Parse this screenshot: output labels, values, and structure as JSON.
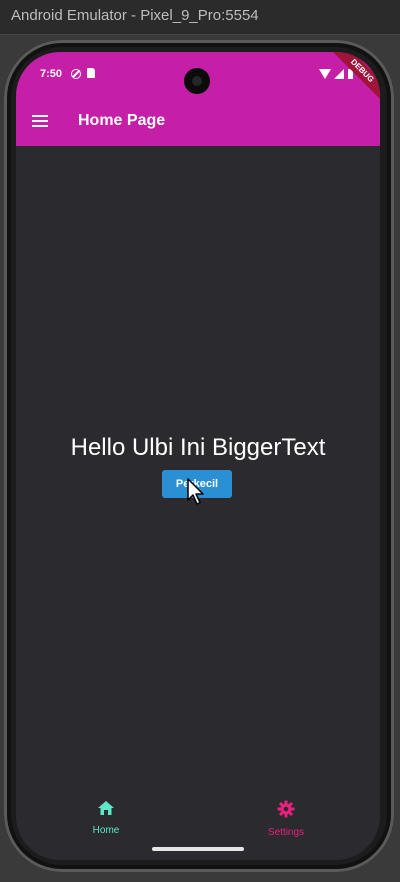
{
  "window": {
    "title": "Android Emulator - Pixel_9_Pro:5554"
  },
  "status_bar": {
    "time": "7:50"
  },
  "debug_banner": "DEBUG",
  "app_bar": {
    "title": "Home Page"
  },
  "content": {
    "greeting": "Hello Ulbi Ini BiggerText",
    "button_label": "Perkecil"
  },
  "bottom_nav": {
    "items": [
      {
        "label": "Home",
        "icon": "home-icon",
        "color": "#5de6c8"
      },
      {
        "label": "Settings",
        "icon": "gear-icon",
        "color": "#e9207d"
      }
    ]
  },
  "colors": {
    "app_bar": "#c41fa6",
    "background": "#2b2a2e",
    "button": "#2b8fd4"
  }
}
